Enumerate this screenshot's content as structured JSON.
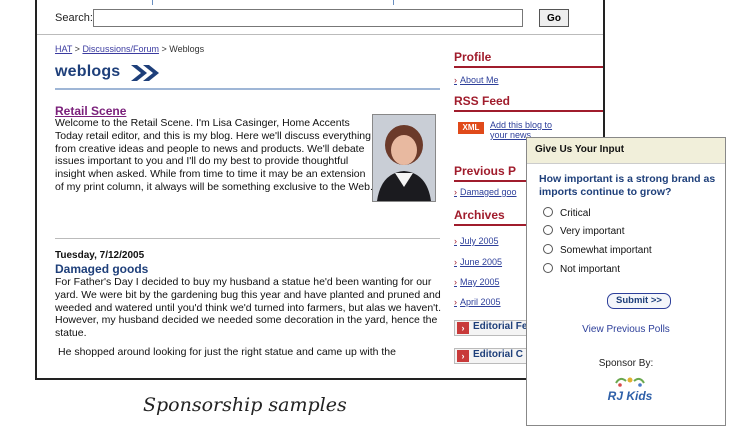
{
  "search": {
    "label": "Search:",
    "value": "",
    "go": "Go"
  },
  "breadcrumb": {
    "home": "HAT",
    "sep": " > ",
    "forum": "Discussions/Forum",
    "current": "Weblogs"
  },
  "weblogs_title": "weblogs",
  "article": {
    "title": "Retail Scene",
    "body": "Welcome to the Retail Scene. I'm Lisa Casinger, Home Accents Today retail editor, and this is my blog. Here we'll discuss everything from creative ideas and people to news and products. We'll debate issues important to you and I'll do my best to provide thoughtful insight when asked. While from time to time it may be an extension of my print column, it always will be something exclusive to the Web."
  },
  "post": {
    "date": "Tuesday, 7/12/2005",
    "title": "Damaged goods",
    "body": "For Father's Day I decided to buy my husband a statue he'd been wanting for our yard. We were bit by the gardening bug this year and have planted and pruned and weeded and watered until you'd think we'd turned into farmers, but alas we haven't. However, my husband decided we needed some decoration in the yard, hence the statue.",
    "body2": "He shopped around looking for just the right statue and came up with the"
  },
  "sidebar": {
    "profile": "Profile",
    "about_me": "About Me",
    "rss": "RSS Feed",
    "xml": "XML",
    "rss_link": "Add this blog to your news",
    "previous": "Previous P",
    "previous_link": "Damaged goo",
    "archives": "Archives",
    "archive_items": [
      "July 2005",
      "June 2005",
      "May 2005",
      "April 2005"
    ],
    "editorial1": "Editorial Fe",
    "editorial2": "Editorial C"
  },
  "poll": {
    "header": "Give Us Your Input",
    "question": "How important is a strong brand as imports continue to grow?",
    "options": [
      "Critical",
      "Very important",
      "Somewhat important",
      "Not important"
    ],
    "submit": "Submit >>",
    "previous": "View Previous Polls",
    "sponsor": "Sponsor By:",
    "logo_text": "RJ Kids"
  },
  "caption": "Sponsorship samples",
  "colors": {
    "accent_red": "#a01c2c",
    "link_blue": "#2d3f9a",
    "heading_blue": "#1e3f7a",
    "xml_orange": "#e04a1a"
  }
}
